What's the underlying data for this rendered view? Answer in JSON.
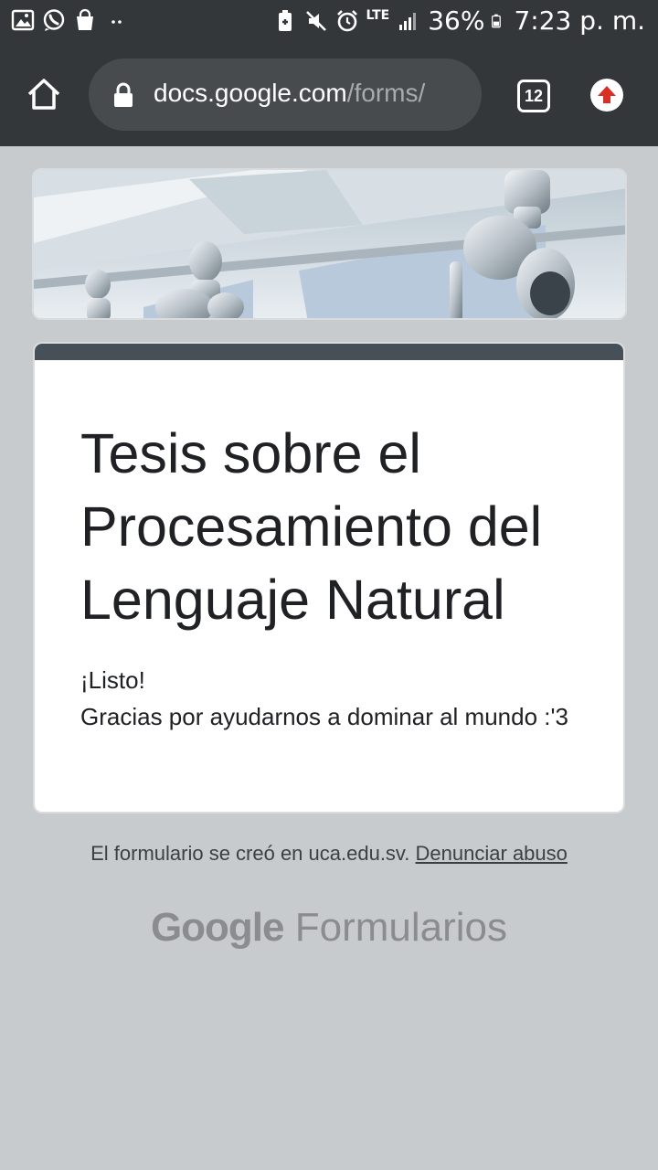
{
  "status_bar": {
    "notification_icons": [
      "gallery-icon",
      "whatsapp-icon",
      "shopping-bag-icon",
      "more-dots-icon"
    ],
    "system_icons": [
      "battery-saver-icon",
      "mute-icon",
      "alarm-icon",
      "lte-icon",
      "signal-icon",
      "battery-icon"
    ],
    "network": "LTE",
    "battery": "36%",
    "time": "7:23 p. m."
  },
  "browser": {
    "url_host": "docs.google.com",
    "url_path": "/forms/",
    "tab_count": "12"
  },
  "form": {
    "title": "Tesis sobre el Procesamiento del Lenguaje Natural",
    "message_line1": "¡Listo!",
    "message_line2": "Gracias por ayudarnos a dominar al mundo :'3"
  },
  "footer": {
    "created_text": "El formulario se creó en uca.edu.sv.",
    "report_link": "Denunciar abuso"
  },
  "brand": {
    "google": "Google",
    "product": "Formularios"
  },
  "colors": {
    "toolbar": "#343739",
    "page_background": "#c8cbce",
    "card_accent": "#485057",
    "update_arrow": "#d93025"
  }
}
